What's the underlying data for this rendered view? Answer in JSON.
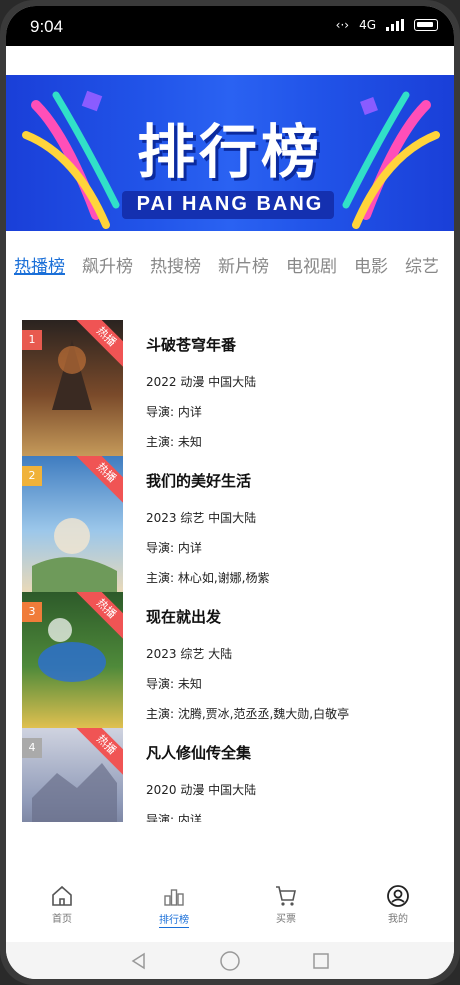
{
  "status": {
    "time": "9:04",
    "network": "4G"
  },
  "banner": {
    "title": "排行榜",
    "subtitle": "PAI HANG BANG"
  },
  "tabs": [
    {
      "label": "热播榜",
      "active": true
    },
    {
      "label": "飙升榜"
    },
    {
      "label": "热搜榜"
    },
    {
      "label": "新片榜"
    },
    {
      "label": "电视剧"
    },
    {
      "label": "电影"
    },
    {
      "label": "综艺"
    }
  ],
  "items": [
    {
      "rank": "1",
      "badge": "热播",
      "title": "斗破苍穹年番",
      "meta": "2022 动漫 中国大陆",
      "director": "导演: 内详",
      "cast": "主演: 未知",
      "poster_colors": [
        "#2a2320",
        "#7a4a2a",
        "#c59a5a"
      ],
      "rank_color": "#e85a4f"
    },
    {
      "rank": "2",
      "badge": "热播",
      "title": "我们的美好生活",
      "meta": "2023 综艺 中国大陆",
      "director": "导演: 内详",
      "cast": "主演: 林心如,谢娜,杨紫",
      "poster_colors": [
        "#3f7cc0",
        "#9cc7ea",
        "#e9d9b8"
      ],
      "rank_color": "#f0b23a"
    },
    {
      "rank": "3",
      "badge": "热播",
      "title": "现在就出发",
      "meta": "2023 综艺 大陆",
      "director": "导演: 未知",
      "cast": "主演: 沈腾,贾冰,范丞丞,魏大勋,白敬亭",
      "poster_colors": [
        "#2d5a2a",
        "#4f8a3a",
        "#e0c050"
      ],
      "rank_color": "#f07c3a"
    },
    {
      "rank": "4",
      "badge": "热播",
      "title": "凡人修仙传全集",
      "meta": "2020 动漫 中国大陆",
      "director": "导演: 内详",
      "cast": "",
      "poster_colors": [
        "#cfd3e0",
        "#8f9ab8",
        "#5a5f7a"
      ],
      "rank_color": "#aaaaaa"
    }
  ],
  "bottom_nav": [
    {
      "label": "首页",
      "icon": "home-icon"
    },
    {
      "label": "排行榜",
      "icon": "ranking-icon",
      "active": true
    },
    {
      "label": "买票",
      "icon": "cart-icon"
    },
    {
      "label": "我的",
      "icon": "user-icon"
    }
  ],
  "colors": {
    "accent": "#1a6fd8",
    "hot": "#f05454",
    "banner": "#2153e8"
  }
}
